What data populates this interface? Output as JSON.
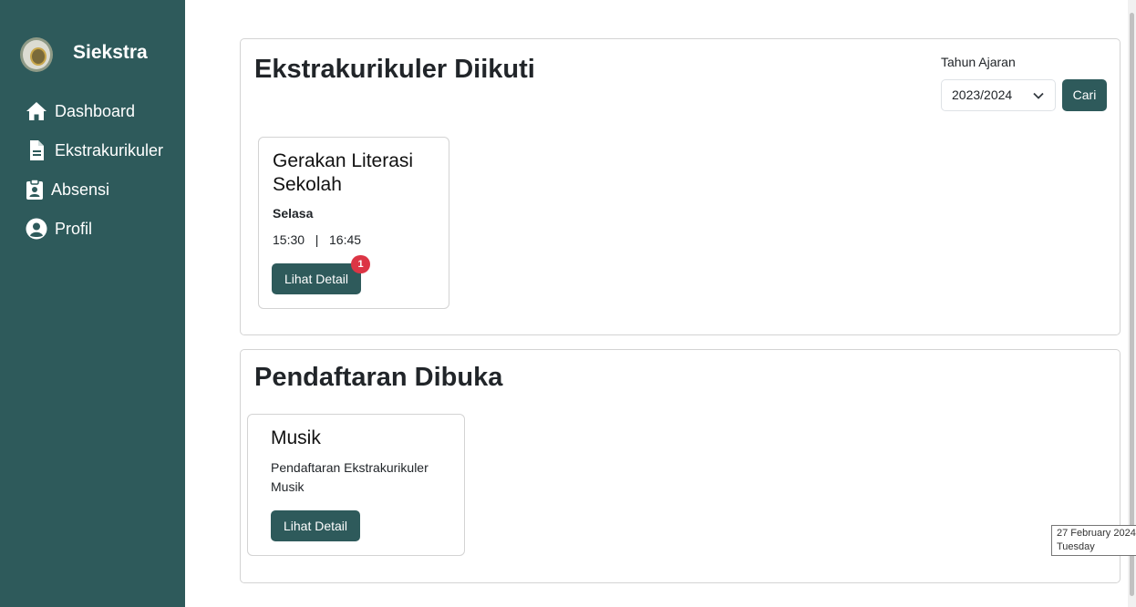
{
  "app": {
    "name": "Siekstra"
  },
  "sidebar": {
    "items": [
      {
        "label": "Dashboard",
        "icon": "home-icon"
      },
      {
        "label": "Ekstrakurikuler",
        "icon": "document-icon"
      },
      {
        "label": "Absensi",
        "icon": "clipboard-user-icon"
      },
      {
        "label": "Profil",
        "icon": "user-circle-icon"
      }
    ]
  },
  "followed": {
    "title": "Ekstrakurikuler Diikuti",
    "filter": {
      "label": "Tahun Ajaran",
      "selected": "2023/2024",
      "search_button": "Cari"
    },
    "items": [
      {
        "name": "Gerakan Literasi Sekolah",
        "day": "Selasa",
        "time": "15:30   |   16:45",
        "button": "Lihat Detail",
        "badge": "1"
      }
    ]
  },
  "open_registration": {
    "title": "Pendaftaran Dibuka",
    "items": [
      {
        "name": "Musik",
        "description": "Pendaftaran Ekstrakurikuler Musik",
        "button": "Lihat Detail"
      }
    ]
  },
  "tooltip": {
    "date": "27 February 2024",
    "day": "Tuesday"
  },
  "colors": {
    "sidebar": "#2e5a5b",
    "primary_button": "#2e5a5b",
    "badge": "#dc3545"
  }
}
